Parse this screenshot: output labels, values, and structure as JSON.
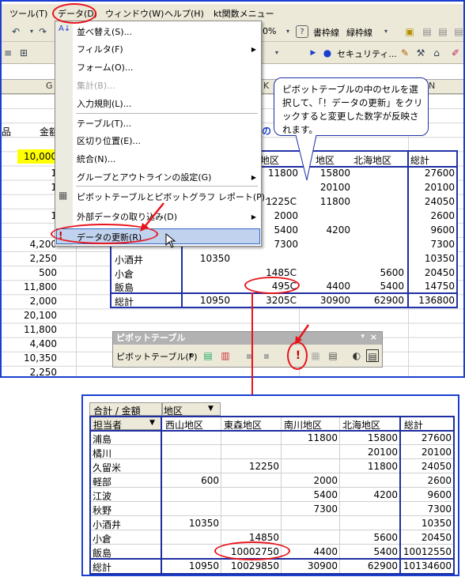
{
  "menubar": {
    "items": [
      "ツール(T)",
      "データ(D)",
      "ウィンドウ(W)",
      "ヘルプ(H)",
      "kt関数メニュー"
    ]
  },
  "toolbar": {
    "zoom": "0%",
    "grid_menu_1": "書枠線",
    "grid_menu_2": "緑枠線",
    "security": "セキュリティ..."
  },
  "columns": {
    "g": "G",
    "k": "K",
    "n": "N"
  },
  "sheet": {
    "label_amount": "金額",
    "highlight_value": "10,000",
    "left_values": [
      "1",
      "1",
      "1",
      "4,200",
      "2,250",
      "500",
      "11,800",
      "2,000",
      "20,100",
      "11,800",
      "4,400",
      "10,350",
      "2,250"
    ]
  },
  "data_menu": {
    "items": [
      {
        "label": "並べ替え(S)...",
        "disabled": false
      },
      {
        "label": "フィルタ(F)",
        "disabled": false,
        "submenu": true
      },
      {
        "label": "フォーム(O)...",
        "disabled": false
      },
      {
        "label": "集計(B)...",
        "disabled": true
      },
      {
        "label": "入力規則(L)...",
        "disabled": false
      },
      {
        "label": "テーブル(T)...",
        "disabled": false
      },
      {
        "label": "区切り位置(E)...",
        "disabled": false
      },
      {
        "label": "統合(N)...",
        "disabled": false
      },
      {
        "label": "グループとアウトラインの設定(G)",
        "disabled": false,
        "submenu": true
      },
      {
        "label": "ピボットテーブルとピボットグラフ レポート(P)...",
        "disabled": false
      },
      {
        "label": "外部データの取り込み(D)",
        "disabled": false,
        "submenu": true
      },
      {
        "label": "データの更新(R)",
        "disabled": false
      }
    ]
  },
  "callout": {
    "text": "ピボットテーブルの中のセルを選択して、「！データの更新」をクリックすると変更した数字が反映されます。"
  },
  "pivot_top": {
    "headers": [
      "森地区",
      "地区",
      "北海地区",
      "総計"
    ],
    "rows": [
      {
        "name": "",
        "vals": [
          "",
          "11800",
          "15800",
          "27600"
        ]
      },
      {
        "name": "",
        "vals": [
          "",
          "",
          "20100",
          "20100"
        ]
      },
      {
        "name": "",
        "vals": [
          "1225C",
          "",
          "11800",
          "24050"
        ]
      },
      {
        "name": "",
        "vals": [
          "",
          "2000",
          "",
          "2600"
        ]
      },
      {
        "name": "",
        "vals": [
          "",
          "5400",
          "4200",
          "9600"
        ]
      },
      {
        "name": "",
        "vals": [
          "",
          "7300",
          "",
          "7300"
        ]
      },
      {
        "name": "小酒井",
        "c1": "10350",
        "vals": [
          "",
          "",
          "",
          "10350"
        ]
      },
      {
        "name": "小倉",
        "vals": [
          "1485C",
          "",
          "5600",
          "20450"
        ]
      },
      {
        "name": "飯島",
        "vals": [
          "495C",
          "4400",
          "5400",
          "14750"
        ]
      },
      {
        "name": "総計",
        "c1": "10950",
        "vals": [
          "3205C",
          "30900",
          "62900",
          "136800"
        ]
      }
    ],
    "title_fragment": "の"
  },
  "pt_toolbar": {
    "title": "ピボットテーブル",
    "menu_label": "ピボットテーブル(P)"
  },
  "pivot_bottom": {
    "corner": "合計 / 金額",
    "field": "地区",
    "row_field": "担当者",
    "headers": [
      "西山地区",
      "東森地区",
      "南川地区",
      "北海地区",
      "総計"
    ],
    "rows": [
      {
        "name": "浦島",
        "vals": [
          "",
          "",
          "11800",
          "15800",
          "27600"
        ]
      },
      {
        "name": "橘川",
        "vals": [
          "",
          "",
          "",
          "20100",
          "20100"
        ]
      },
      {
        "name": "久留米",
        "vals": [
          "",
          "12250",
          "",
          "11800",
          "24050"
        ]
      },
      {
        "name": "軽部",
        "vals": [
          "600",
          "",
          "2000",
          "",
          "2600"
        ]
      },
      {
        "name": "江波",
        "vals": [
          "",
          "",
          "5400",
          "4200",
          "9600"
        ]
      },
      {
        "name": "秋野",
        "vals": [
          "",
          "",
          "7300",
          "",
          "7300"
        ]
      },
      {
        "name": "小酒井",
        "vals": [
          "10350",
          "",
          "",
          "",
          "10350"
        ]
      },
      {
        "name": "小倉",
        "vals": [
          "",
          "14850",
          "",
          "5600",
          "20450"
        ]
      },
      {
        "name": "飯島",
        "vals": [
          "",
          "10002750",
          "4400",
          "5400",
          "10012550"
        ]
      },
      {
        "name": "総計",
        "vals": [
          "10950",
          "10029850",
          "30900",
          "62900",
          "10134600"
        ]
      }
    ]
  },
  "colors": {
    "frame_blue": "#1a3fd0",
    "annotation_red": "#e8141c",
    "highlight_yellow": "#ffff00",
    "menu_highlight": "#c1d2ee"
  }
}
